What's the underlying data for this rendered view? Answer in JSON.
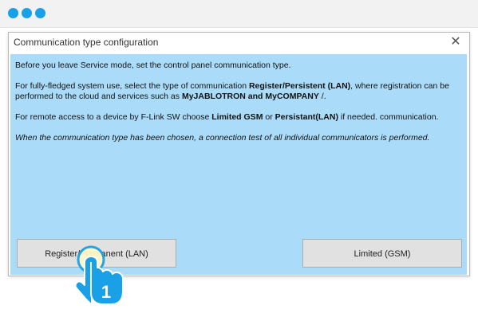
{
  "browser": {
    "dots": [
      "dot-1",
      "dot-2",
      "dot-3"
    ]
  },
  "dialog": {
    "title": "Communication type configuration",
    "close_icon": "close-icon"
  },
  "content": {
    "p1": "Before you leave Service mode, set the control panel communication type.",
    "p2_parts": [
      "For fully-fledged system use, select the type of communication ",
      "Register/Persistent (LAN)",
      ", where registration can be performed to the cloud and services such as ",
      "MyJABLOTRON and MyCOMPANY",
      " /."
    ],
    "p3_parts": [
      "For remote access to a device by F-Link SW choose ",
      "Limited GSM",
      " or ",
      "Persistant(LAN)",
      " if needed. communication."
    ],
    "p4": "When the communication type has been chosen, a connection test of all individual communicators is performed."
  },
  "buttons": {
    "left_label": "Register/Permanent (LAN)",
    "right_label": "Limited (GSM)"
  },
  "cursor": {
    "step_number": "1",
    "icon": "hand-pointer-icon"
  },
  "colors": {
    "accent": "#1aa0e6",
    "content_bg": "#aadcfa",
    "button_bg": "#e1e1e1"
  }
}
